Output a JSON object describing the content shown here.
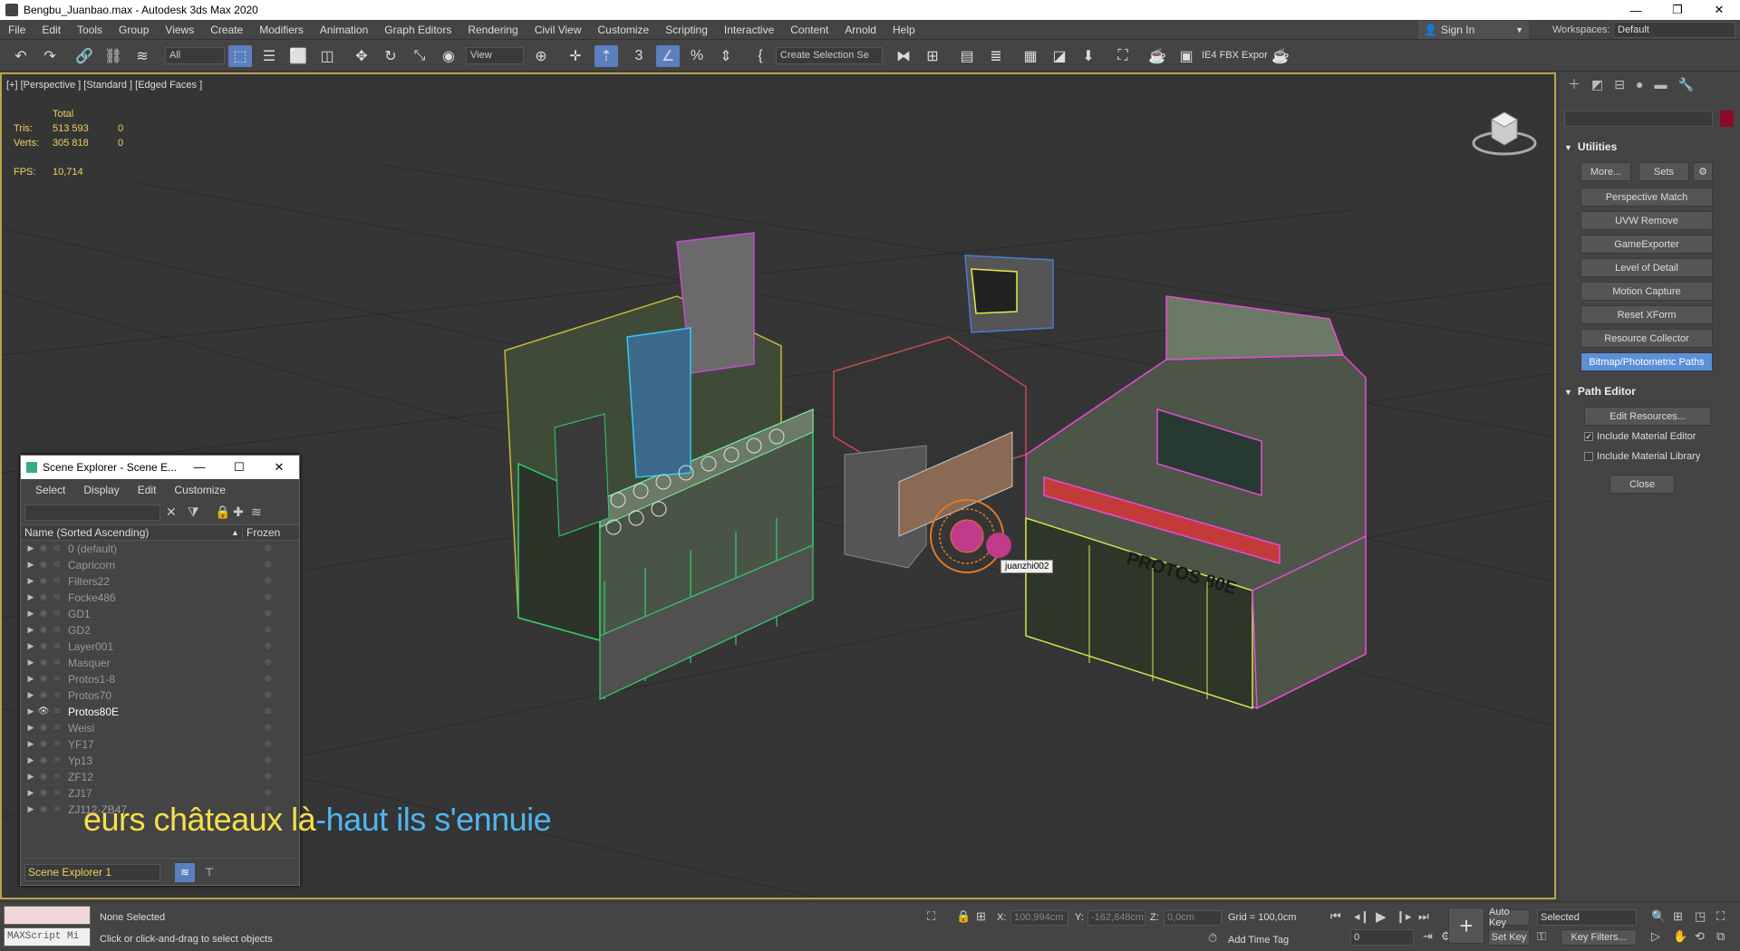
{
  "window": {
    "title": "Bengbu_Juanbao.max - Autodesk 3ds Max 2020",
    "minimize": "—",
    "restore": "❐",
    "close": "✕"
  },
  "menu": [
    "File",
    "Edit",
    "Tools",
    "Group",
    "Views",
    "Create",
    "Modifiers",
    "Animation",
    "Graph Editors",
    "Rendering",
    "Civil View",
    "Customize",
    "Scripting",
    "Interactive",
    "Content",
    "Arnold",
    "Help"
  ],
  "account": {
    "sign_in": "Sign In",
    "workspaces_label": "Workspaces:",
    "workspace": "Default"
  },
  "toolbar": {
    "selection_filter": "All",
    "ref_coord": "View",
    "named_selection": "Create Selection Se",
    "exporter_label": "IE4 FBX Expor"
  },
  "viewport": {
    "label": "[+] [Perspective ] [Standard ] [Edged Faces ]",
    "stats": {
      "header": "Total",
      "tris_label": "Tris:",
      "tris_total": "513 593",
      "tris_sel": "0",
      "verts_label": "Verts:",
      "verts_total": "305 818",
      "verts_sel": "0",
      "fps_label": "FPS:",
      "fps": "10,714"
    },
    "tooltip": "juanzhi002",
    "machine_text": "PROTOS 80E",
    "subtitle_yellow": "eurs châteaux là",
    "subtitle_cyan": "-haut ils s'ennuie"
  },
  "scene_explorer": {
    "title": "Scene Explorer - Scene E...",
    "menu": [
      "Select",
      "Display",
      "Edit",
      "Customize"
    ],
    "col_name": "Name (Sorted Ascending)",
    "col_frozen": "Frozen",
    "layers": [
      {
        "name": "0 (default)",
        "current": false
      },
      {
        "name": "Capricorn",
        "current": false
      },
      {
        "name": "Filters22",
        "current": false
      },
      {
        "name": "Focke486",
        "current": false
      },
      {
        "name": "GD1",
        "current": false
      },
      {
        "name": "GD2",
        "current": false
      },
      {
        "name": "Layer001",
        "current": false
      },
      {
        "name": "Masquer",
        "current": false
      },
      {
        "name": "Protos1-8",
        "current": false
      },
      {
        "name": "Protos70",
        "current": false
      },
      {
        "name": "Protos80E",
        "current": true
      },
      {
        "name": "Weisi",
        "current": false
      },
      {
        "name": "YF17",
        "current": false
      },
      {
        "name": "Yp13",
        "current": false
      },
      {
        "name": "ZF12",
        "current": false
      },
      {
        "name": "ZJ17",
        "current": false
      },
      {
        "name": "ZJ112-ZB47",
        "current": false
      }
    ],
    "explorer_name": "Scene Explorer 1"
  },
  "command_panel": {
    "utilities_title": "Utilities",
    "more": "More...",
    "sets": "Sets",
    "utilities": [
      "Perspective Match",
      "UVW Remove",
      "GameExporter",
      "Level of Detail",
      "Motion Capture",
      "Reset XForm",
      "Resource Collector",
      "Bitmap/Photometric Paths"
    ],
    "path_editor_title": "Path Editor",
    "edit_resources": "Edit Resources...",
    "include_material_editor": "Include Material Editor",
    "include_material_library": "Include Material Library",
    "close": "Close"
  },
  "status": {
    "maxscript": "MAXScript Mi",
    "selection": "None Selected",
    "prompt": "Click or click-and-drag to select objects",
    "x_label": "X:",
    "x": "100,994cm",
    "y_label": "Y:",
    "y": "-162,848cm",
    "z_label": "Z:",
    "z": "0,0cm",
    "grid": "Grid = 100,0cm",
    "add_time_tag": "Add Time Tag",
    "auto_key": "Auto Key",
    "set_key": "Set Key",
    "key_mode": "Selected",
    "frame": "0",
    "key_filters": "Key Filters..."
  }
}
